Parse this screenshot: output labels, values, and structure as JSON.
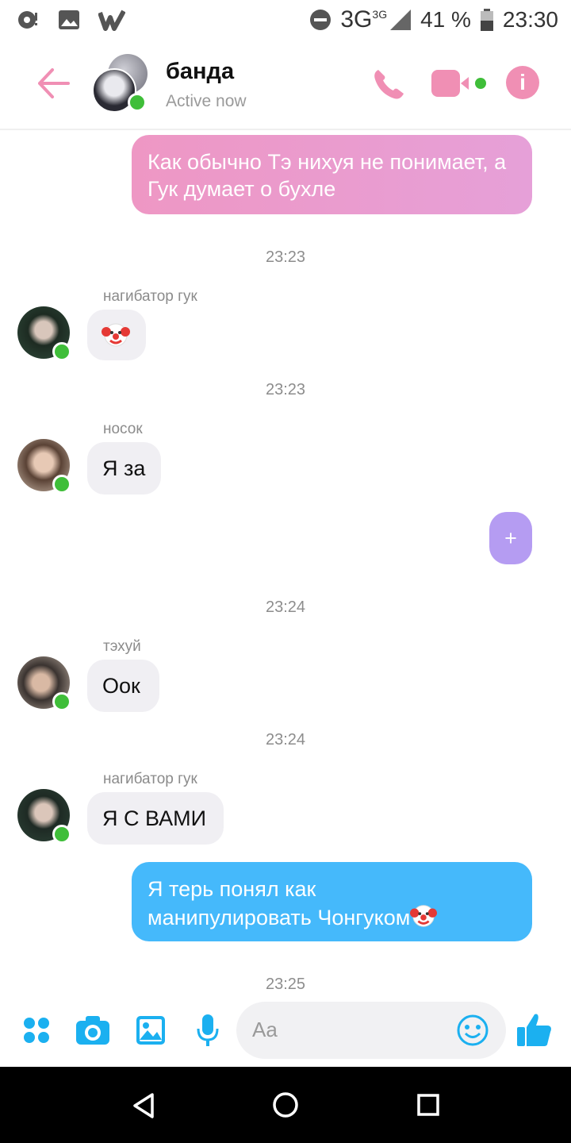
{
  "status_bar": {
    "network": "3G",
    "network_sup": "3G",
    "battery": "41 %",
    "time": "23:30"
  },
  "header": {
    "title": "банда",
    "subtitle": "Active now",
    "accent_color": "#f08fb4"
  },
  "messages": [
    {
      "type": "outgoing",
      "style": "pink",
      "text": "Как обычно Тэ нихуя не понимает, а Гук думает о бухле"
    },
    {
      "type": "time",
      "text": "23:23"
    },
    {
      "type": "incoming",
      "sender": "нагибатор гук",
      "text": "",
      "emoji": "clown-emoji"
    },
    {
      "type": "time",
      "text": "23:23"
    },
    {
      "type": "incoming",
      "sender": "носок",
      "text": "Я за"
    },
    {
      "type": "outgoing",
      "style": "purple",
      "text": "+"
    },
    {
      "type": "time",
      "text": "23:24"
    },
    {
      "type": "incoming",
      "sender": "тэхуй",
      "text": "Оок"
    },
    {
      "type": "time",
      "text": "23:24"
    },
    {
      "type": "incoming",
      "sender": "нагибатор гук",
      "text": "Я С ВАМИ"
    },
    {
      "type": "outgoing",
      "style": "blue",
      "text_line1": "Я терь понял как",
      "text_line2": "манипулировать Чонгуком",
      "emoji": "clown-emoji"
    },
    {
      "type": "time",
      "text": "23:25"
    }
  ],
  "composer": {
    "placeholder": "Aa",
    "accent_color": "#1bb0f0"
  }
}
